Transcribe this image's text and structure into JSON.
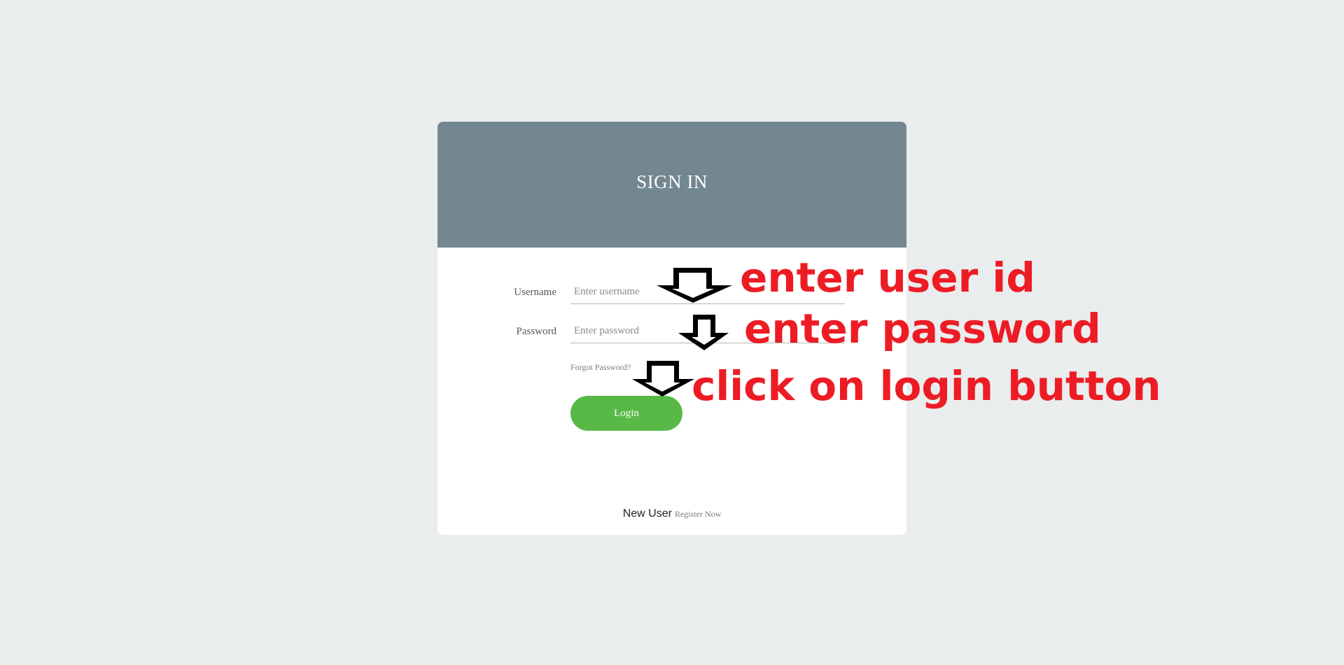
{
  "card": {
    "title": "SIGN IN",
    "header_color": "#738790"
  },
  "form": {
    "username": {
      "label": "Username",
      "placeholder": "Enter username",
      "value": ""
    },
    "password": {
      "label": "Password",
      "placeholder": "Enter password",
      "value": ""
    },
    "forgot_password_label": "Forgot Password?",
    "login_label": "Login",
    "login_color": "#58b947"
  },
  "footer": {
    "new_user_text": "New User",
    "register_label": "Register Now"
  },
  "annotations": {
    "username_hint": "enter user id",
    "password_hint": "enter password",
    "login_hint": "click on login button",
    "color": "#ed1c24",
    "arrow_icon": "down-arrow-icon"
  }
}
